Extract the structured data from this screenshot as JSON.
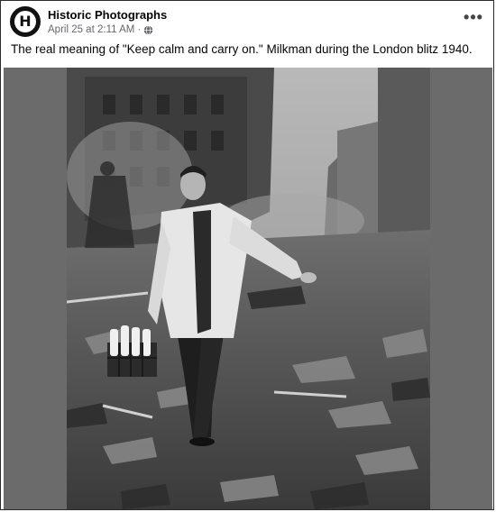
{
  "post": {
    "page_name": "Historic Photographs",
    "avatar_letter": "H",
    "timestamp": "April 25 at 2:11 AM",
    "separator": "·",
    "privacy_icon": "globe-icon",
    "more_icon": "more-options-icon",
    "more_label": "•••",
    "caption": "The real meaning of \"Keep calm and carry on.\" Milkman during the London blitz 1940."
  },
  "photo": {
    "subject": "black-and-white photo of milkman carrying crate of milk bottles through bombed street rubble"
  },
  "colors": {
    "photo_letterbox": "#6b6b6b",
    "meta_text": "#65676b",
    "name_text": "#050505"
  }
}
